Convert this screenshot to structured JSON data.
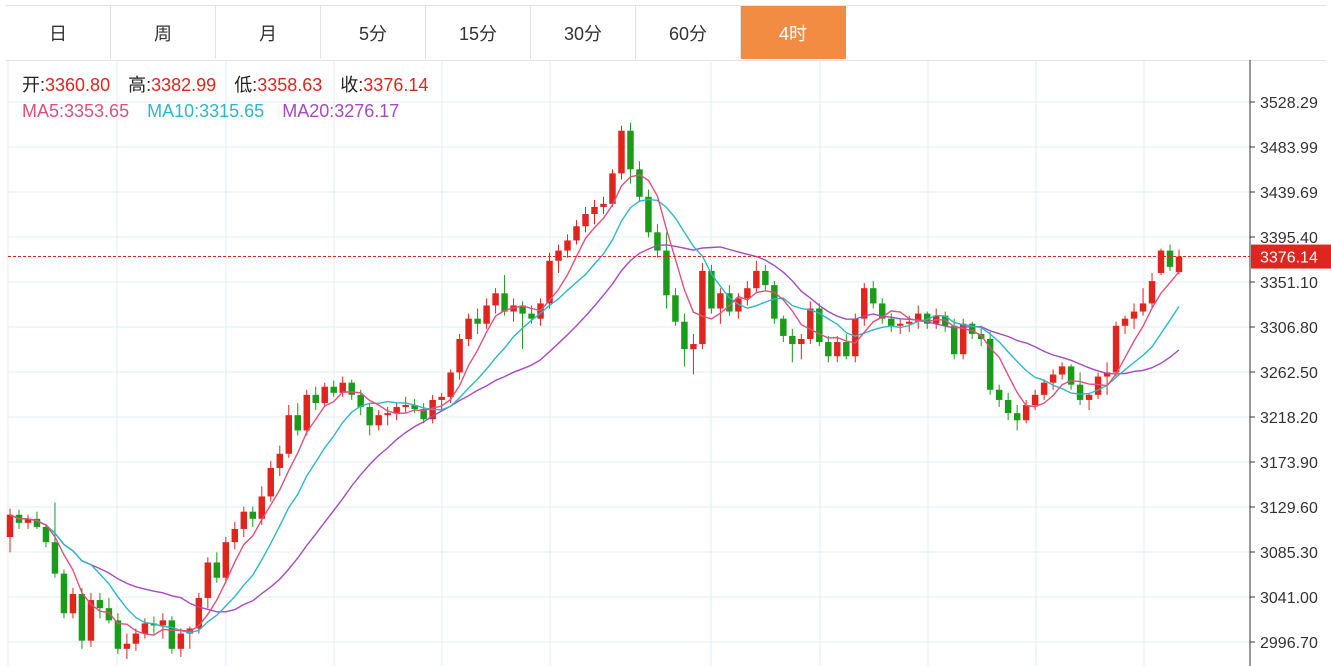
{
  "tabs": [
    {
      "label": "日",
      "active": false
    },
    {
      "label": "周",
      "active": false
    },
    {
      "label": "月",
      "active": false
    },
    {
      "label": "5分",
      "active": false
    },
    {
      "label": "15分",
      "active": false
    },
    {
      "label": "30分",
      "active": false
    },
    {
      "label": "60分",
      "active": false
    },
    {
      "label": "4时",
      "active": true
    }
  ],
  "legend": {
    "open_label": "开:",
    "open": "3360.80",
    "high_label": "高:",
    "high": "3382.99",
    "low_label": "低:",
    "low": "3358.63",
    "close_label": "收:",
    "close": "3376.14",
    "ma5_label": "MA5:",
    "ma5": "3353.65",
    "ma10_label": "MA10:",
    "ma10": "3315.65",
    "ma20_label": "MA20:",
    "ma20": "3276.17"
  },
  "colors": {
    "up": "#e0251f",
    "down": "#1a9b1a",
    "ma5": "#e0507c",
    "ma10": "#2bb8c8",
    "ma20": "#a44bc0",
    "accent": "#f28c43",
    "last_price": "#e0251f"
  },
  "chart_data": {
    "type": "candlestick",
    "yticks": [
      "3528.29",
      "3483.99",
      "3439.69",
      "3395.40",
      "3351.10",
      "3306.80",
      "3262.50",
      "3218.20",
      "3173.90",
      "3129.60",
      "3085.30",
      "3041.00",
      "2996.70"
    ],
    "ylim": [
      2975,
      3580
    ],
    "last_price": 3376.14,
    "last_price_label": "3376.14",
    "grid": true,
    "ohlc": [
      [
        3100,
        3128,
        3085,
        3122
      ],
      [
        3122,
        3127,
        3108,
        3114
      ],
      [
        3114,
        3122,
        3108,
        3118
      ],
      [
        3118,
        3125,
        3108,
        3110
      ],
      [
        3110,
        3113,
        3090,
        3095
      ],
      [
        3095,
        3134,
        3060,
        3064
      ],
      [
        3064,
        3068,
        3020,
        3025
      ],
      [
        3025,
        3050,
        3020,
        3044
      ],
      [
        3044,
        3050,
        2990,
        2998
      ],
      [
        2998,
        3045,
        2992,
        3038
      ],
      [
        3038,
        3045,
        3020,
        3030
      ],
      [
        3030,
        3040,
        3015,
        3018
      ],
      [
        3018,
        3025,
        2985,
        2990
      ],
      [
        2990,
        3005,
        2980,
        2995
      ],
      [
        2995,
        3010,
        2988,
        3005
      ],
      [
        3005,
        3020,
        3000,
        3015
      ],
      [
        3015,
        3022,
        3005,
        3013
      ],
      [
        3013,
        3025,
        3000,
        3018
      ],
      [
        3018,
        3022,
        2985,
        2990
      ],
      [
        2990,
        3010,
        2982,
        3005
      ],
      [
        3005,
        3012,
        2990,
        3010
      ],
      [
        3010,
        3045,
        3005,
        3040
      ],
      [
        3040,
        3080,
        3030,
        3075
      ],
      [
        3075,
        3085,
        3055,
        3060
      ],
      [
        3060,
        3100,
        3055,
        3095
      ],
      [
        3095,
        3115,
        3088,
        3108
      ],
      [
        3108,
        3130,
        3100,
        3125
      ],
      [
        3125,
        3130,
        3110,
        3118
      ],
      [
        3118,
        3150,
        3112,
        3140
      ],
      [
        3140,
        3175,
        3135,
        3168
      ],
      [
        3168,
        3190,
        3160,
        3182
      ],
      [
        3182,
        3230,
        3178,
        3220
      ],
      [
        3220,
        3232,
        3200,
        3205
      ],
      [
        3205,
        3245,
        3200,
        3240
      ],
      [
        3240,
        3248,
        3225,
        3232
      ],
      [
        3232,
        3252,
        3228,
        3248
      ],
      [
        3248,
        3254,
        3238,
        3242
      ],
      [
        3242,
        3258,
        3238,
        3252
      ],
      [
        3252,
        3255,
        3235,
        3240
      ],
      [
        3240,
        3245,
        3220,
        3228
      ],
      [
        3228,
        3232,
        3200,
        3210
      ],
      [
        3210,
        3225,
        3205,
        3220
      ],
      [
        3220,
        3228,
        3210,
        3222
      ],
      [
        3222,
        3232,
        3215,
        3228
      ],
      [
        3228,
        3238,
        3222,
        3230
      ],
      [
        3230,
        3236,
        3222,
        3226
      ],
      [
        3226,
        3232,
        3212,
        3216
      ],
      [
        3216,
        3240,
        3212,
        3235
      ],
      [
        3235,
        3242,
        3225,
        3238
      ],
      [
        3238,
        3265,
        3232,
        3262
      ],
      [
        3262,
        3300,
        3255,
        3295
      ],
      [
        3295,
        3320,
        3288,
        3315
      ],
      [
        3315,
        3325,
        3300,
        3310
      ],
      [
        3310,
        3335,
        3305,
        3328
      ],
      [
        3328,
        3345,
        3320,
        3340
      ],
      [
        3340,
        3358,
        3318,
        3322
      ],
      [
        3322,
        3335,
        3312,
        3328
      ],
      [
        3328,
        3332,
        3285,
        3320
      ],
      [
        3320,
        3328,
        3310,
        3315
      ],
      [
        3315,
        3335,
        3308,
        3330
      ],
      [
        3330,
        3380,
        3325,
        3372
      ],
      [
        3372,
        3388,
        3360,
        3382
      ],
      [
        3382,
        3398,
        3375,
        3392
      ],
      [
        3392,
        3412,
        3388,
        3406
      ],
      [
        3406,
        3425,
        3400,
        3418
      ],
      [
        3418,
        3432,
        3408,
        3425
      ],
      [
        3425,
        3435,
        3418,
        3428
      ],
      [
        3428,
        3462,
        3425,
        3458
      ],
      [
        3458,
        3505,
        3452,
        3500
      ],
      [
        3500,
        3508,
        3448,
        3462
      ],
      [
        3462,
        3470,
        3430,
        3435
      ],
      [
        3435,
        3442,
        3395,
        3400
      ],
      [
        3400,
        3408,
        3375,
        3382
      ],
      [
        3382,
        3400,
        3325,
        3338
      ],
      [
        3338,
        3345,
        3308,
        3312
      ],
      [
        3312,
        3320,
        3268,
        3285
      ],
      [
        3285,
        3300,
        3260,
        3290
      ],
      [
        3290,
        3370,
        3285,
        3362
      ],
      [
        3362,
        3368,
        3320,
        3325
      ],
      [
        3325,
        3345,
        3310,
        3340
      ],
      [
        3340,
        3348,
        3318,
        3322
      ],
      [
        3322,
        3340,
        3315,
        3335
      ],
      [
        3335,
        3352,
        3328,
        3345
      ],
      [
        3345,
        3372,
        3340,
        3362
      ],
      [
        3362,
        3368,
        3342,
        3348
      ],
      [
        3348,
        3352,
        3310,
        3315
      ],
      [
        3315,
        3318,
        3292,
        3298
      ],
      [
        3298,
        3305,
        3272,
        3290
      ],
      [
        3290,
        3300,
        3275,
        3295
      ],
      [
        3295,
        3332,
        3290,
        3325
      ],
      [
        3325,
        3330,
        3288,
        3292
      ],
      [
        3292,
        3298,
        3272,
        3278
      ],
      [
        3278,
        3298,
        3272,
        3292
      ],
      [
        3292,
        3300,
        3275,
        3278
      ],
      [
        3278,
        3320,
        3272,
        3315
      ],
      [
        3315,
        3350,
        3308,
        3345
      ],
      [
        3345,
        3352,
        3325,
        3330
      ],
      [
        3330,
        3335,
        3310,
        3315
      ],
      [
        3315,
        3320,
        3302,
        3308
      ],
      [
        3308,
        3315,
        3300,
        3310
      ],
      [
        3310,
        3318,
        3302,
        3312
      ],
      [
        3312,
        3328,
        3305,
        3320
      ],
      [
        3320,
        3322,
        3305,
        3310
      ],
      [
        3310,
        3325,
        3305,
        3318
      ],
      [
        3318,
        3322,
        3302,
        3308
      ],
      [
        3308,
        3315,
        3275,
        3280
      ],
      [
        3280,
        3315,
        3275,
        3310
      ],
      [
        3310,
        3312,
        3295,
        3300
      ],
      [
        3300,
        3308,
        3288,
        3295
      ],
      [
        3295,
        3302,
        3240,
        3245
      ],
      [
        3245,
        3250,
        3228,
        3235
      ],
      [
        3235,
        3242,
        3215,
        3222
      ],
      [
        3222,
        3230,
        3205,
        3215
      ],
      [
        3215,
        3235,
        3212,
        3230
      ],
      [
        3230,
        3245,
        3225,
        3240
      ],
      [
        3240,
        3255,
        3235,
        3252
      ],
      [
        3252,
        3265,
        3245,
        3260
      ],
      [
        3260,
        3272,
        3255,
        3268
      ],
      [
        3268,
        3270,
        3245,
        3250
      ],
      [
        3250,
        3262,
        3230,
        3235
      ],
      [
        3235,
        3242,
        3225,
        3240
      ],
      [
        3240,
        3262,
        3236,
        3258
      ],
      [
        3258,
        3272,
        3240,
        3262
      ],
      [
        3262,
        3312,
        3258,
        3308
      ],
      [
        3308,
        3318,
        3300,
        3315
      ],
      [
        3315,
        3330,
        3305,
        3322
      ],
      [
        3322,
        3345,
        3318,
        3330
      ],
      [
        3330,
        3360,
        3325,
        3352
      ],
      [
        3360,
        3384,
        3358,
        3382
      ],
      [
        3382,
        3388,
        3362,
        3366
      ],
      [
        3360.8,
        3382.99,
        3358.63,
        3376.14
      ]
    ]
  }
}
